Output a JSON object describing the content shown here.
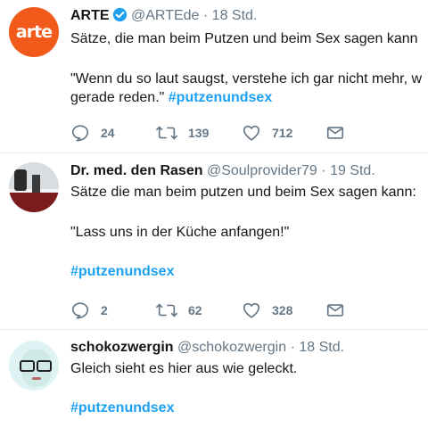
{
  "tweets": [
    {
      "name": "ARTE",
      "verified": true,
      "handle": "@ARTEde",
      "time": "18 Std.",
      "avatar_text": "arte",
      "line1": "Sätze, die man beim Putzen und beim Sex sagen kann",
      "line2": "\"Wenn du so laut saugst, verstehe ich gar nicht mehr, w",
      "line3": "gerade reden.\"",
      "hashtag": "#putzenundsex",
      "replies": "24",
      "retweets": "139",
      "likes": "712"
    },
    {
      "name": "Dr. med. den Rasen",
      "handle": "@Soulprovider79",
      "time": "19 Std.",
      "line1": "Sätze die man beim putzen und beim Sex sagen kann:",
      "line2": "\"Lass uns in der Küche anfangen!\"",
      "hashtag": "#putzenundsex",
      "replies": "2",
      "retweets": "62",
      "likes": "328"
    },
    {
      "name": "schokozwergin",
      "handle": "@schokozwergin",
      "time": "18 Std.",
      "line1": "Gleich sieht es hier aus wie geleckt.",
      "hashtag": "#putzenundsex"
    }
  ],
  "colors": {
    "accent": "#1da1f2",
    "secondary_text": "#657786",
    "arte_orange": "#f25a1b",
    "divider": "#e6ecf0"
  },
  "icons": [
    "reply-icon",
    "retweet-icon",
    "like-icon",
    "direct-message-icon",
    "verified-badge-icon"
  ]
}
